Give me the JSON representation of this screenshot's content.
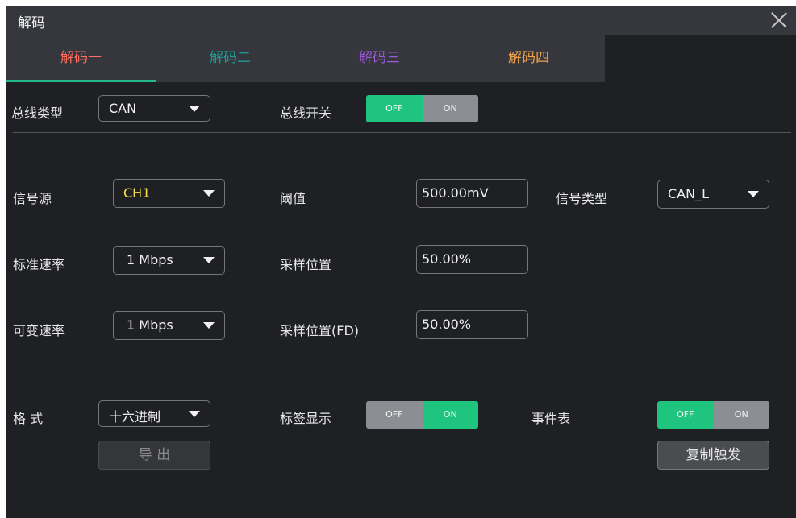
{
  "window": {
    "title": "解码"
  },
  "tabs": [
    {
      "label": "解码一",
      "color": "#ff6f61",
      "active": true
    },
    {
      "label": "解码二",
      "color": "#1f9a93",
      "active": false
    },
    {
      "label": "解码三",
      "color": "#9b59d6",
      "active": false
    },
    {
      "label": "解码四",
      "color": "#f0a04b",
      "active": false
    }
  ],
  "bus": {
    "type_label": "总线类型",
    "type_value": "CAN",
    "switch_label": "总线开关",
    "switch_off": "OFF",
    "switch_on": "ON",
    "switch_state": "OFF"
  },
  "settings": {
    "source_label": "信号源",
    "source_value": "CH1",
    "source_color": "#f5e04a",
    "threshold_label": "阈值",
    "threshold_value": "500.00mV",
    "signal_type_label": "信号类型",
    "signal_type_value": "CAN_L",
    "std_rate_label": "标准速率",
    "std_rate_value": "1 Mbps",
    "sample_pos_label": "采样位置",
    "sample_pos_value": "50.00%",
    "var_rate_label": "可变速率",
    "var_rate_value": "1 Mbps",
    "sample_pos_fd_label": "采样位置(FD)",
    "sample_pos_fd_value": "50.00%"
  },
  "bottom": {
    "format_label": "格 式",
    "format_value": "十六进制",
    "tag_label": "标签显示",
    "tag_off": "OFF",
    "tag_on": "ON",
    "tag_state": "ON",
    "event_label": "事件表",
    "event_off": "OFF",
    "event_on": "ON",
    "event_state": "OFF",
    "export_label": "导 出",
    "copy_trigger_label": "复制触发"
  },
  "colors": {
    "accent": "#25b889",
    "toggle_active": "#1fc57f",
    "background": "#1f2023"
  }
}
